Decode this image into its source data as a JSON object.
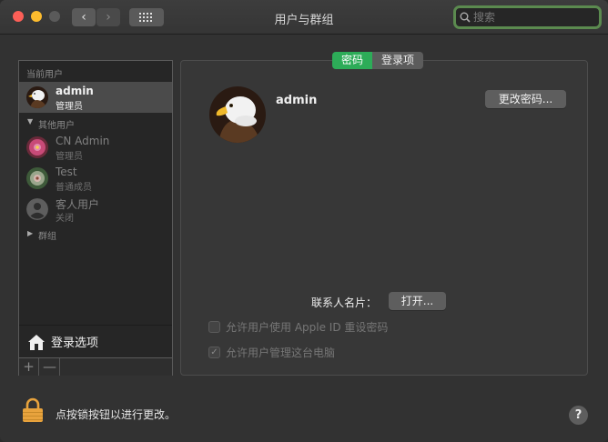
{
  "window": {
    "title": "用户与群组",
    "search_placeholder": "搜索"
  },
  "sidebar": {
    "current_users_label": "当前用户",
    "current_user": {
      "name": "admin",
      "role": "管理员"
    },
    "other_users_label": "其他用户",
    "other_users": [
      {
        "name": "CN Admin",
        "role": "管理员"
      },
      {
        "name": "Test",
        "role": "普通成员"
      },
      {
        "name": "客人用户",
        "role": "关闭"
      }
    ],
    "groups_label": "群组",
    "login_options_label": "登录选项",
    "add_label": "+",
    "remove_label": "—"
  },
  "panel": {
    "tabs": [
      "密码",
      "登录项"
    ],
    "active_tab": "密码",
    "user_name": "admin",
    "change_password_label": "更改密码...",
    "contact_card_label": "联系人名片：",
    "open_label": "打开...",
    "allow_apple_id_reset": {
      "label": "允许用户使用 Apple ID 重设密码",
      "checked": false
    },
    "allow_admin": {
      "label": "允许用户管理这台电脑",
      "checked": true
    }
  },
  "footer": {
    "lock_text": "点按锁按钮以进行更改。",
    "help_label": "?"
  },
  "colors": {
    "accent_tab": "#2dac58",
    "search_focus_ring": "#5b8a4f",
    "lock_body": "#e8a33d"
  }
}
